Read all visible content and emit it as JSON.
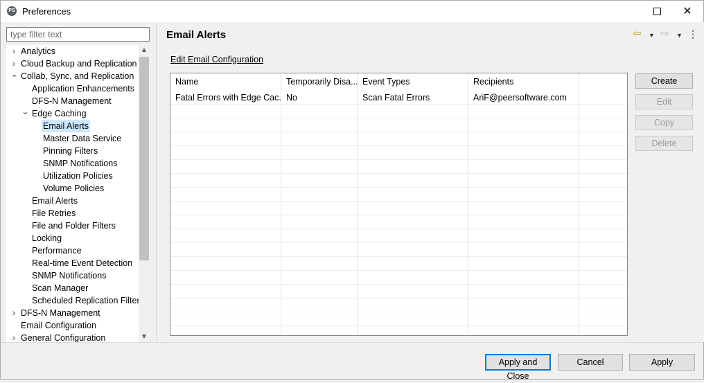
{
  "window": {
    "title": "Preferences",
    "controls": {
      "help": "?",
      "minimize": "",
      "maximize": "",
      "close": "✕"
    }
  },
  "filter": {
    "placeholder": "type filter text",
    "value": ""
  },
  "tree": [
    {
      "label": "Analytics",
      "level": 0,
      "expander": "collapsed"
    },
    {
      "label": "Cloud Backup and Replication",
      "level": 0,
      "expander": "collapsed"
    },
    {
      "label": "Collab, Sync, and Replication",
      "level": 0,
      "expander": "expanded"
    },
    {
      "label": "Application Enhancements",
      "level": 1,
      "expander": "none"
    },
    {
      "label": "DFS-N Management",
      "level": 1,
      "expander": "none"
    },
    {
      "label": "Edge Caching",
      "level": 1,
      "expander": "expanded"
    },
    {
      "label": "Email Alerts",
      "level": 2,
      "expander": "none",
      "selected": true
    },
    {
      "label": "Master Data Service",
      "level": 2,
      "expander": "none"
    },
    {
      "label": "Pinning Filters",
      "level": 2,
      "expander": "none"
    },
    {
      "label": "SNMP Notifications",
      "level": 2,
      "expander": "none"
    },
    {
      "label": "Utilization Policies",
      "level": 2,
      "expander": "none"
    },
    {
      "label": "Volume Policies",
      "level": 2,
      "expander": "none"
    },
    {
      "label": "Email Alerts",
      "level": 1,
      "expander": "none"
    },
    {
      "label": "File Retries",
      "level": 1,
      "expander": "none"
    },
    {
      "label": "File and Folder Filters",
      "level": 1,
      "expander": "none"
    },
    {
      "label": "Locking",
      "level": 1,
      "expander": "none"
    },
    {
      "label": "Performance",
      "level": 1,
      "expander": "none"
    },
    {
      "label": "Real-time Event Detection",
      "level": 1,
      "expander": "none"
    },
    {
      "label": "SNMP Notifications",
      "level": 1,
      "expander": "none"
    },
    {
      "label": "Scan Manager",
      "level": 1,
      "expander": "none"
    },
    {
      "label": "Scheduled Replication Filters",
      "level": 1,
      "expander": "none"
    },
    {
      "label": "DFS-N Management",
      "level": 0,
      "expander": "collapsed"
    },
    {
      "label": "Email Configuration",
      "level": 0,
      "expander": "none"
    },
    {
      "label": "General Configuration",
      "level": 0,
      "expander": "collapsed"
    }
  ],
  "page": {
    "title": "Email Alerts",
    "edit_link": "Edit Email Configuration"
  },
  "table": {
    "columns": [
      "Name",
      "Temporarily Disa...",
      "Event Types",
      "Recipients",
      ""
    ],
    "rows": [
      [
        "Fatal Errors with Edge Cac...",
        "No",
        "Scan Fatal Errors",
        "AriF@peersoftware.com",
        ""
      ]
    ]
  },
  "side_buttons": [
    {
      "label": "Create",
      "enabled": true
    },
    {
      "label": "Edit",
      "enabled": false
    },
    {
      "label": "Copy",
      "enabled": false
    },
    {
      "label": "Delete",
      "enabled": false
    }
  ],
  "footer": {
    "apply_close": "Apply and Close",
    "cancel": "Cancel",
    "apply": "Apply"
  },
  "icons": {
    "back": "back-arrow-icon",
    "forward": "forward-arrow-icon",
    "menu": "view-menu-icon"
  },
  "colors": {
    "selection": "#cce8ff",
    "default_button_border": "#0078d7",
    "back_arrow": "#c89a1d"
  }
}
